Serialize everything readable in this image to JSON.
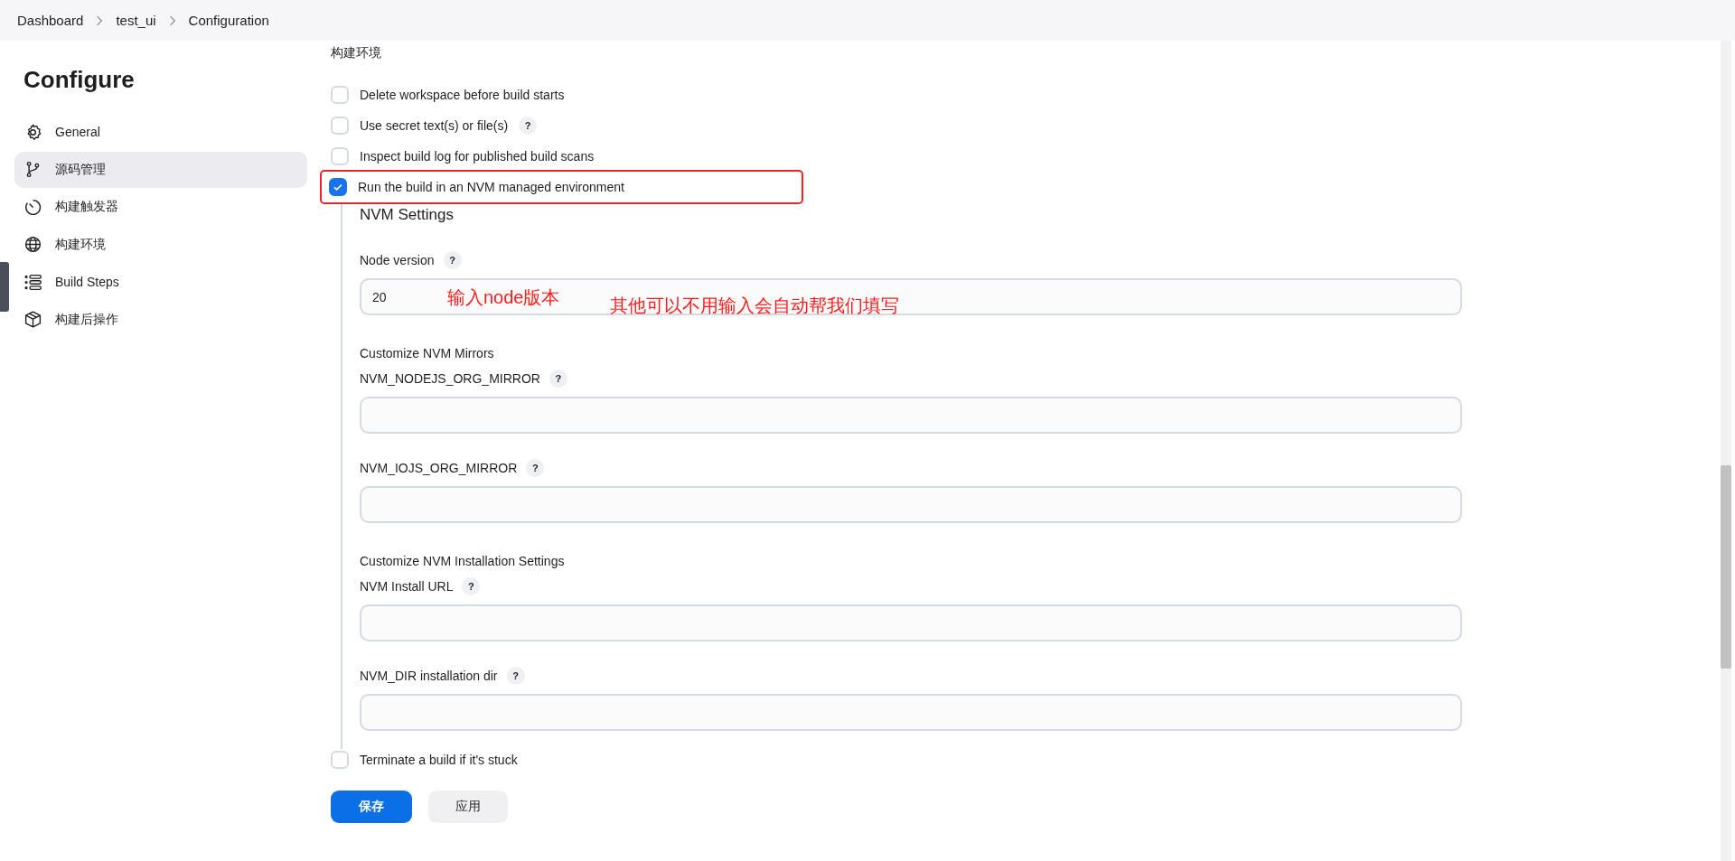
{
  "breadcrumb": [
    {
      "label": "Dashboard"
    },
    {
      "label": "test_ui"
    },
    {
      "label": "Configuration"
    }
  ],
  "sidebar": {
    "title": "Configure",
    "items": [
      {
        "label": "General",
        "selected": false
      },
      {
        "label": "源码管理",
        "selected": true
      },
      {
        "label": "构建触发器",
        "selected": false
      },
      {
        "label": "构建环境",
        "selected": false
      },
      {
        "label": "Build Steps",
        "selected": false
      },
      {
        "label": "构建后操作",
        "selected": false
      }
    ]
  },
  "section": {
    "title": "构建环境",
    "options": [
      {
        "label": "Delete workspace before build starts",
        "checked": false,
        "highlighted": false
      },
      {
        "label": "Use secret text(s) or file(s)",
        "checked": false,
        "help": "?",
        "highlighted": false
      },
      {
        "label": "Inspect build log for published build scans",
        "checked": false,
        "highlighted": false
      },
      {
        "label": "Run the build in an NVM managed environment",
        "checked": true,
        "highlighted": true
      }
    ]
  },
  "nvm_settings": {
    "title": "NVM Settings",
    "items": [
      {
        "kind": "field",
        "label": "Node version",
        "help": "?",
        "value": "20",
        "annotations": [
          "输入node版本",
          "其他可以不用输入会自动帮我们填写"
        ]
      },
      {
        "kind": "group",
        "label": "Customize NVM Mirrors"
      },
      {
        "kind": "field",
        "label": "NVM_NODEJS_ORG_MIRROR",
        "help": "?"
      },
      {
        "kind": "field",
        "label": "NVM_IOJS_ORG_MIRROR",
        "help": "?"
      },
      {
        "kind": "group",
        "label": "Customize NVM Installation Settings"
      },
      {
        "kind": "field",
        "label": "NVM Install URL",
        "help": "?"
      },
      {
        "kind": "field",
        "label": "NVM_DIR installation dir",
        "help": "?"
      }
    ]
  },
  "more_options": [
    {
      "label": "Terminate a build if it's stuck",
      "checked": false
    }
  ],
  "buttons": [
    {
      "label": "保存",
      "kind": "primary"
    },
    {
      "label": "应用",
      "kind": "secondary"
    }
  ]
}
